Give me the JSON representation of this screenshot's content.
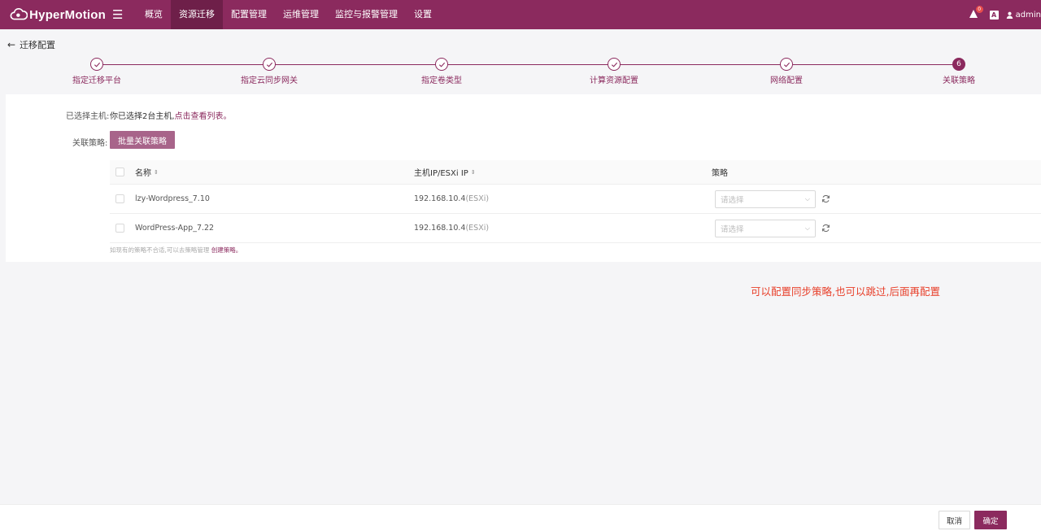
{
  "brand": {
    "name": "HyperMotion",
    "accent": "#8b2a5e"
  },
  "nav": {
    "menu_icon": "hamburger-icon",
    "items": [
      "概览",
      "资源迁移",
      "配置管理",
      "运维管理",
      "监控与报警管理",
      "设置"
    ],
    "active_index": 1
  },
  "topright": {
    "notification_count": "0",
    "lang_label": "A",
    "username": "admin"
  },
  "page": {
    "back_title": "迁移配置"
  },
  "steps": [
    {
      "label": "指定迁移平台",
      "number": "1",
      "state": "done"
    },
    {
      "label": "指定云同步网关",
      "number": "2",
      "state": "done"
    },
    {
      "label": "指定卷类型",
      "number": "3",
      "state": "done"
    },
    {
      "label": "计算资源配置",
      "number": "4",
      "state": "done"
    },
    {
      "label": "网络配置",
      "number": "5",
      "state": "done"
    },
    {
      "label": "关联策略",
      "number": "6",
      "state": "current"
    }
  ],
  "form": {
    "selected_label": "已选择主机:",
    "selected_text": "你已选择2台主机,",
    "selected_link": "点击查看列表。",
    "policy_label": "关联策略:",
    "batch_button": "批量关联策略"
  },
  "table": {
    "headers": {
      "name": "名称",
      "ip": "主机IP/ESXi IP",
      "policy": "策略"
    },
    "rows": [
      {
        "name": "lzy-Wordpress_7.10",
        "ip": "192.168.10.4",
        "ip_suffix": "(ESXi)",
        "policy_placeholder": "请选择"
      },
      {
        "name": "WordPress-App_7.22",
        "ip": "192.168.10.4",
        "ip_suffix": "(ESXi)",
        "policy_placeholder": "请选择"
      }
    ],
    "hint_text": "如现有的策略不合适,可以去策略管理",
    "hint_link": "创建策略。"
  },
  "annotation": "可以配置同步策略,也可以跳过,后面再配置",
  "footer": {
    "cancel": "取消",
    "confirm": "确定"
  }
}
